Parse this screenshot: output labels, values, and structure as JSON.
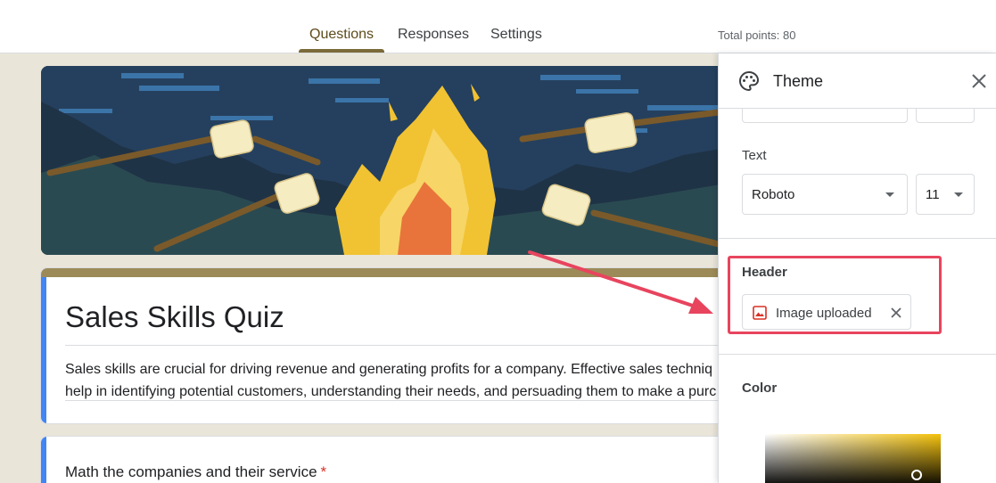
{
  "tabs": [
    {
      "label": "Questions",
      "active": true
    },
    {
      "label": "Responses",
      "active": false
    },
    {
      "label": "Settings",
      "active": false
    }
  ],
  "total_points": "Total points: 80",
  "form": {
    "title": "Sales Skills Quiz",
    "description_line1": "Sales skills are crucial for driving revenue and generating profits for a company. Effective sales techniq",
    "description_line2": "help in identifying potential customers, understanding their needs, and persuading them to make a purc",
    "question": "Math the companies and their service",
    "required_marker": "*",
    "accent_color": "#4285f4",
    "header_strip_color": "#9c8b58"
  },
  "theme_panel": {
    "title": "Theme",
    "text_section_label": "Text",
    "font_value": "Roboto",
    "font_size_value": "11",
    "header_section_label": "Header",
    "header_chip_label": "Image uploaded",
    "color_section_label": "Color",
    "selected_color": "#f4c20d"
  },
  "icons": [
    "palette-icon",
    "close-icon",
    "image-icon",
    "remove-image-icon",
    "chevron-down-icon"
  ],
  "annotation_color": "#e8445e"
}
